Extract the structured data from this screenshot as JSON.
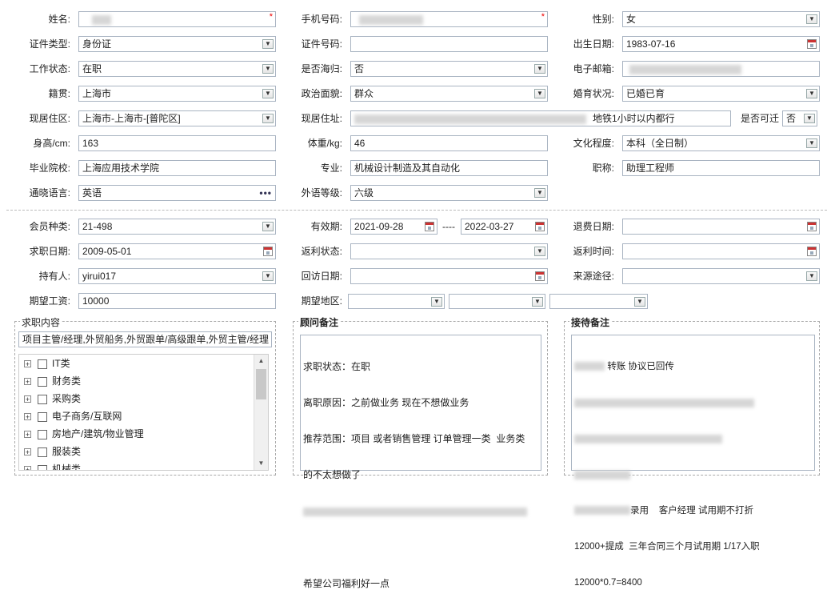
{
  "form": {
    "name_label": "姓名:",
    "phone_label": "手机号码:",
    "gender_label": "性别:",
    "gender_value": "女",
    "idtype_label": "证件类型:",
    "idtype_value": "身份证",
    "idno_label": "证件号码:",
    "idno_value": "",
    "birth_label": "出生日期:",
    "birth_value": "1983-07-16",
    "workstatus_label": "工作状态:",
    "workstatus_value": "在职",
    "overseas_label": "是否海归:",
    "overseas_value": "否",
    "email_label": "电子邮箱:",
    "native_label": "籍贯:",
    "native_value": "上海市",
    "politics_label": "政治面貌:",
    "politics_value": "群众",
    "marital_label": "婚育状况:",
    "marital_value": "已婚已育",
    "residence_label": "现居住区:",
    "residence_value": "上海市-上海市-[普陀区]",
    "address_label": "现居住址:",
    "address_visible": "地铁1小时以内都行",
    "relocate_label": "是否可迁",
    "relocate_value": "否",
    "height_label": "身高/cm:",
    "height_value": "163",
    "weight_label": "体重/kg:",
    "weight_value": "46",
    "education_label": "文化程度:",
    "education_value": "本科（全日制）",
    "school_label": "毕业院校:",
    "school_value": "上海应用技术学院",
    "major_label": "专业:",
    "major_value": "机械设计制造及其自动化",
    "title_label": "职称:",
    "title_value": "助理工程师",
    "language_label": "通晓语言:",
    "language_value": "英语",
    "flevel_label": "外语等级:",
    "flevel_value": "六级"
  },
  "member": {
    "type_label": "会员种类:",
    "type_value": "21-498",
    "valid_label": "有效期:",
    "valid_from": "2021-09-28",
    "valid_sep": "----",
    "valid_to": "2022-03-27",
    "refund_label": "退费日期:",
    "refund_value": "",
    "jobdate_label": "求职日期:",
    "jobdate_value": "2009-05-01",
    "rebate_label": "返利状态:",
    "rebate_value": "",
    "rebatetime_label": "返利时间:",
    "rebatetime_value": "",
    "holder_label": "持有人:",
    "holder_value": "yirui017",
    "visit_label": "回访日期:",
    "visit_value": "",
    "source_label": "来源途径:",
    "source_value": "",
    "salary_label": "期望工资:",
    "salary_value": "10000",
    "region_label": "期望地区:"
  },
  "job_panel": {
    "title": "求职内容",
    "summary": "项目主管/经理,外贸船务,外贸跟单/高级跟单,外贸主管/经理",
    "categories": [
      "IT类",
      "财务类",
      "采购类",
      "电子商务/互联网",
      "房地产/建筑/物业管理",
      "服装类",
      "机械类"
    ]
  },
  "advisor_panel": {
    "title": "顾问备注",
    "line1": "求职状态：在职",
    "line2": "离职原因：之前做业务 现在不想做业务",
    "line3": "推荐范围：项目 或者销售管理 订单管理一类  业务类",
    "line4": "的不太想做了",
    "line6": "希望公司福利好一点"
  },
  "reception_panel": {
    "title": "接待备注",
    "line1": "转账 协议已回传",
    "line5": "录用    客户经理 试用期不打折",
    "line6": "12000+提成  三年合同三个月试用期 1/17入职",
    "line7": "12000*0.7=8400"
  }
}
